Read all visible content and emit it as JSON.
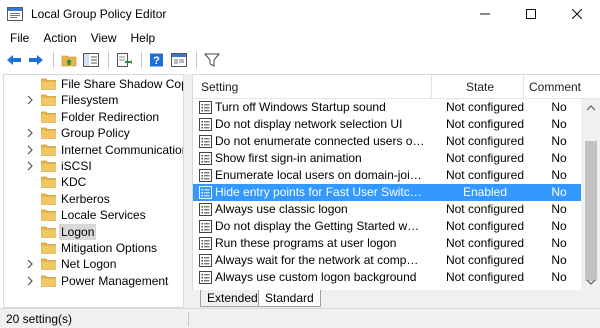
{
  "window": {
    "title": "Local Group Policy Editor",
    "minimize_icon": "minimize-icon",
    "maximize_icon": "maximize-icon",
    "close_icon": "close-icon"
  },
  "menu": {
    "items": [
      {
        "label": "File"
      },
      {
        "label": "Action"
      },
      {
        "label": "View"
      },
      {
        "label": "Help"
      }
    ]
  },
  "toolbar": {
    "icons": [
      "back-arrow-icon",
      "forward-arrow-icon",
      "up-folder-icon",
      "show-hide-tree-icon",
      "export-list-icon",
      "help-icon",
      "properties-icon",
      "filter-icon"
    ]
  },
  "tree": {
    "items": [
      {
        "label": "File Share Shadow Copy",
        "selected": false,
        "expandable": false
      },
      {
        "label": "Filesystem",
        "selected": false,
        "expandable": true
      },
      {
        "label": "Folder Redirection",
        "selected": false,
        "expandable": false
      },
      {
        "label": "Group Policy",
        "selected": false,
        "expandable": true
      },
      {
        "label": "Internet Communication",
        "selected": false,
        "expandable": true
      },
      {
        "label": "iSCSI",
        "selected": false,
        "expandable": true
      },
      {
        "label": "KDC",
        "selected": false,
        "expandable": false
      },
      {
        "label": "Kerberos",
        "selected": false,
        "expandable": false
      },
      {
        "label": "Locale Services",
        "selected": false,
        "expandable": false
      },
      {
        "label": "Logon",
        "selected": true,
        "expandable": false
      },
      {
        "label": "Mitigation Options",
        "selected": false,
        "expandable": false
      },
      {
        "label": "Net Logon",
        "selected": false,
        "expandable": true
      },
      {
        "label": "Power Management",
        "selected": false,
        "expandable": true
      }
    ]
  },
  "list": {
    "columns": {
      "setting": "Setting",
      "state": "State",
      "comment": "Comment"
    },
    "rows": [
      {
        "setting": "Turn off Windows Startup sound",
        "state": "Not configured",
        "comment": "No",
        "selected": false
      },
      {
        "setting": "Do not display network selection UI",
        "state": "Not configured",
        "comment": "No",
        "selected": false
      },
      {
        "setting": "Do not enumerate connected users on do...",
        "state": "Not configured",
        "comment": "No",
        "selected": false
      },
      {
        "setting": "Show first sign-in animation",
        "state": "Not configured",
        "comment": "No",
        "selected": false
      },
      {
        "setting": "Enumerate local users on domain-joined c...",
        "state": "Not configured",
        "comment": "No",
        "selected": false
      },
      {
        "setting": "Hide entry points for Fast User Switching",
        "state": "Enabled",
        "comment": "No",
        "selected": true
      },
      {
        "setting": "Always use classic logon",
        "state": "Not configured",
        "comment": "No",
        "selected": false
      },
      {
        "setting": "Do not display the Getting Started welcome...",
        "state": "Not configured",
        "comment": "No",
        "selected": false
      },
      {
        "setting": "Run these programs at user logon",
        "state": "Not configured",
        "comment": "No",
        "selected": false
      },
      {
        "setting": "Always wait for the network at computer st...",
        "state": "Not configured",
        "comment": "No",
        "selected": false
      },
      {
        "setting": "Always use custom logon background",
        "state": "Not configured",
        "comment": "No",
        "selected": false
      }
    ]
  },
  "tabs": [
    {
      "label": "Extended",
      "active": false
    },
    {
      "label": "Standard",
      "active": true
    }
  ],
  "status": {
    "text": "20 setting(s)"
  },
  "colors": {
    "selection": "#3399ff",
    "folder": "#e8b64c",
    "accent": "#1e6fd9"
  }
}
